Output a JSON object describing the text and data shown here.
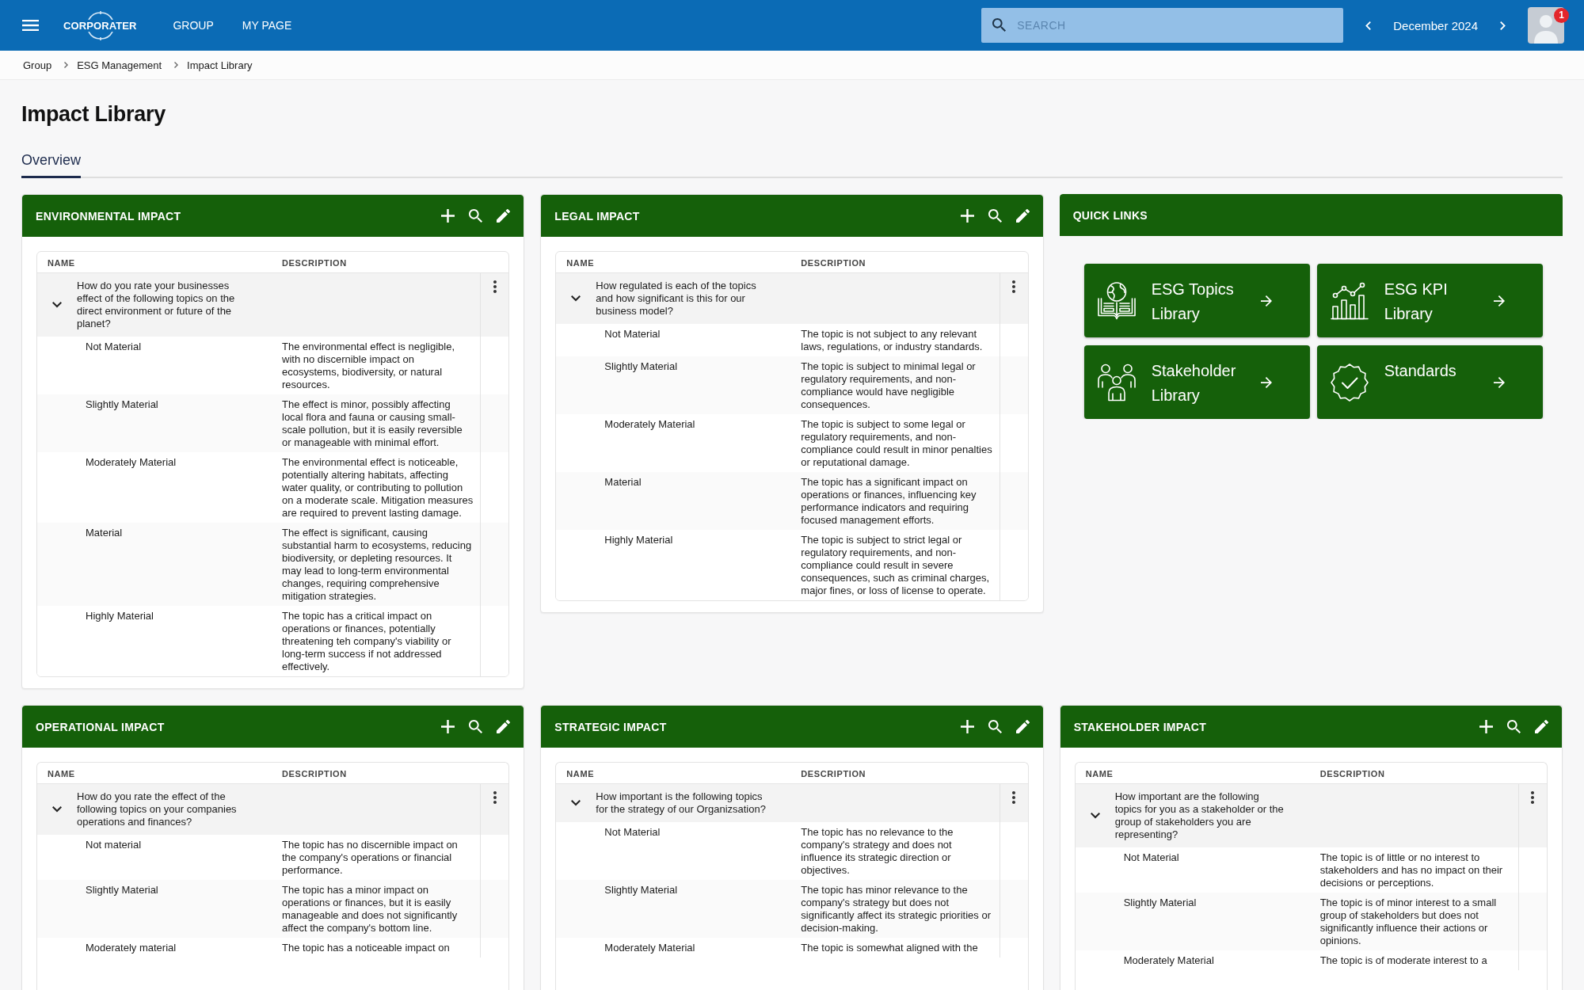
{
  "top_bar": {
    "logo": "CORPORATER",
    "nav": [
      "GROUP",
      "MY PAGE"
    ],
    "search": {
      "placeholder": "SEARCH"
    },
    "period": "December 2024",
    "notifications": "1"
  },
  "breadcrumb": [
    "Group",
    "ESG Management",
    "Impact Library"
  ],
  "page_title": "Impact Library",
  "tabs": [
    {
      "label": "Overview",
      "selected": true
    }
  ],
  "panels": [
    {
      "kind": "table",
      "title": "ENVIRONMENTAL IMPACT",
      "columns": [
        "NAME",
        "DESCRIPTION"
      ],
      "groups": [
        {
          "name": "How do you rate your businesses effect of the following topics on the direct environment or future of the planet?",
          "expanded": true,
          "rows": [
            {
              "name": "Not Material",
              "description": "The environmental effect is negligible, with no discernible impact on ecosystems, biodiversity, or natural resources."
            },
            {
              "name": "Slightly Material",
              "description": "The effect is minor, possibly affecting local flora and fauna or causing small-scale pollution, but it is easily reversible or manageable with minimal effort."
            },
            {
              "name": "Moderately Material",
              "description": "The environmental effect is noticeable, potentially altering habitats, affecting water quality, or contributing to pollution on a moderate scale. Mitigation measures are required to prevent lasting damage."
            },
            {
              "name": "Material",
              "description": "The effect is significant, causing substantial harm to ecosystems, reducing biodiversity, or depleting resources. It may lead to long-term environmental changes, requiring comprehensive mitigation strategies."
            },
            {
              "name": "Highly Material",
              "description": "The topic has a critical impact on operations or finances, potentially threatening teh company's viability or long-term success if not addressed effectively."
            }
          ]
        }
      ]
    },
    {
      "kind": "table",
      "title": "LEGAL IMPACT",
      "columns": [
        "NAME",
        "DESCRIPTION"
      ],
      "groups": [
        {
          "name": "How regulated is each of the topics and how significant is this for our business model?",
          "expanded": true,
          "rows": [
            {
              "name": "Not Material",
              "description": "The topic is not subject to any relevant laws, regulations, or industry standards."
            },
            {
              "name": "Slightly Material",
              "description": "The topic is subject to minimal legal or regulatory requirements, and non-compliance would have negligible consequences."
            },
            {
              "name": "Moderately Material",
              "description": "The topic is subject to some legal or regulatory requirements, and non-compliance could result in minor penalties or reputational damage."
            },
            {
              "name": "Material",
              "description": "The topic has a significant impact on operations or finances, influencing key performance indicators and requiring focused management efforts."
            },
            {
              "name": "Highly Material",
              "description": "The topic is subject to strict legal or regulatory requirements, and non-compliance could result in severe consequences, such as criminal charges, major fines, or loss of license to operate."
            }
          ]
        }
      ]
    },
    {
      "kind": "links",
      "title": "QUICK LINKS",
      "links": [
        {
          "label": "ESG Topics Library",
          "kind": "topics"
        },
        {
          "label": "ESG KPI Library",
          "kind": "kpi"
        },
        {
          "label": "Stakeholder Library",
          "kind": "stakeholders"
        },
        {
          "label": "Standards",
          "kind": "standards"
        }
      ]
    },
    {
      "kind": "table",
      "title": "OPERATIONAL IMPACT",
      "columns": [
        "NAME",
        "DESCRIPTION"
      ],
      "groups": [
        {
          "name": "How do you rate the effect of the following topics on your companies operations and finances?",
          "expanded": true,
          "rows": [
            {
              "name": "Not material",
              "description": "The topic has no discernible impact on the company's operations or financial performance."
            },
            {
              "name": "Slightly Material",
              "description": "The topic has a minor impact on operations or finances, but it is easily manageable and does not significantly affect the company's bottom line."
            },
            {
              "name": "Moderately material",
              "description": "The topic has a noticeable impact on"
            }
          ]
        }
      ]
    },
    {
      "kind": "table",
      "title": "STRATEGIC IMPACT",
      "columns": [
        "NAME",
        "DESCRIPTION"
      ],
      "groups": [
        {
          "name": "How important is the following topics for the strategy of our Organizsation?",
          "expanded": true,
          "rows": [
            {
              "name": "Not Material",
              "description": "The topic has no relevance to the company's strategy and does not influence its strategic direction or objectives."
            },
            {
              "name": "Slightly Material",
              "description": "The topic has minor relevance to the company's strategy but does not significantly affect its strategic priorities or decision-making."
            },
            {
              "name": "Moderately Material",
              "description": "The topic is somewhat aligned with the"
            }
          ]
        }
      ]
    },
    {
      "kind": "table",
      "title": "STAKEHOLDER IMPACT",
      "columns": [
        "NAME",
        "DESCRIPTION"
      ],
      "groups": [
        {
          "name": "How important are the following topics for you as a stakeholder or the group of stakeholders you are representing?",
          "expanded": true,
          "rows": [
            {
              "name": "Not Material",
              "description": "The topic is of little or no interest to stakeholders and has no impact on their decisions or perceptions."
            },
            {
              "name": "Slightly Material",
              "description": "The topic is of minor interest to a small group of stakeholders but does not significantly influence their actions or opinions."
            },
            {
              "name": "Moderately Material",
              "description": "The topic is of moderate interest to a"
            }
          ]
        }
      ]
    }
  ]
}
